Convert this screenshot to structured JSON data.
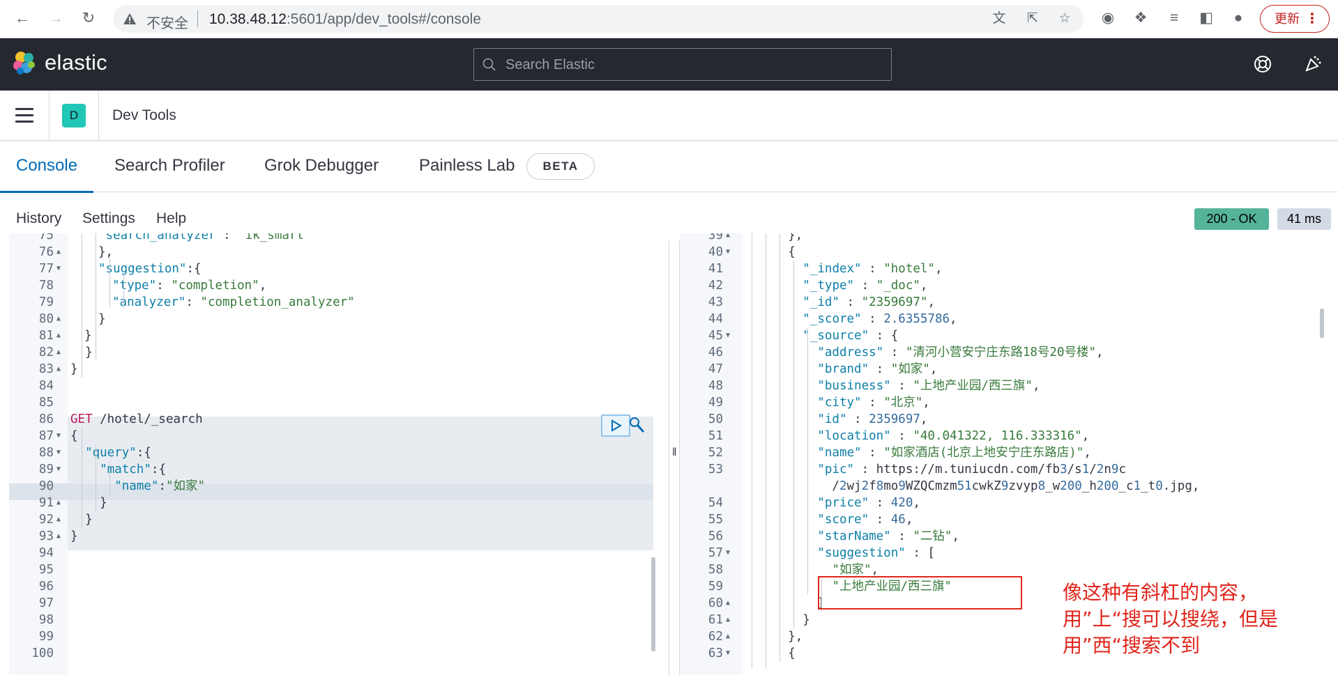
{
  "browser": {
    "insecure_label": "不安全",
    "url_host": "10.38.48.12",
    "url_rest": ":5601/app/dev_tools#/console",
    "update_label": "更新"
  },
  "header": {
    "logo_text": "elastic",
    "search_placeholder": "Search Elastic"
  },
  "breadcrumb": {
    "space_initial": "D",
    "title": "Dev Tools"
  },
  "tabs": [
    {
      "label": "Console"
    },
    {
      "label": "Search Profiler"
    },
    {
      "label": "Grok Debugger"
    },
    {
      "label": "Painless Lab"
    }
  ],
  "beta_label": "BETA",
  "toolbar": {
    "history": "History",
    "settings": "Settings",
    "help": "Help"
  },
  "response_status": "200 - OK",
  "response_time": "41 ms",
  "request_lines": [
    {
      "n": "75",
      "fold": "",
      "indent": 2,
      "text": "\"search_analyzer\": \"ik_smart\""
    },
    {
      "n": "76",
      "fold": "▲",
      "indent": 2,
      "text": "},"
    },
    {
      "n": "77",
      "fold": "▼",
      "indent": 2,
      "text": "\"suggestion\":{"
    },
    {
      "n": "78",
      "fold": "",
      "indent": 3,
      "text": "\"type\": \"completion\","
    },
    {
      "n": "79",
      "fold": "",
      "indent": 3,
      "text": "\"analyzer\": \"completion_analyzer\""
    },
    {
      "n": "80",
      "fold": "▲",
      "indent": 2,
      "text": "}"
    },
    {
      "n": "81",
      "fold": "▲",
      "indent": 1,
      "text": "}"
    },
    {
      "n": "82",
      "fold": "▲",
      "indent": 0,
      "text": "  }"
    },
    {
      "n": "83",
      "fold": "▲",
      "indent": 0,
      "text": "}"
    },
    {
      "n": "84",
      "fold": "",
      "indent": 0,
      "text": ""
    },
    {
      "n": "85",
      "fold": "",
      "indent": 0,
      "text": ""
    },
    {
      "n": "86",
      "fold": "",
      "indent": 0,
      "text": "GET /hotel/_search"
    },
    {
      "n": "87",
      "fold": "▼",
      "indent": 0,
      "text": "{"
    },
    {
      "n": "88",
      "fold": "▼",
      "indent": 0,
      "text": "  \"query\":{"
    },
    {
      "n": "89",
      "fold": "▼",
      "indent": 0,
      "text": "    \"match\":{"
    },
    {
      "n": "90",
      "fold": "",
      "indent": 0,
      "text": "      \"name\":\"如家\""
    },
    {
      "n": "91",
      "fold": "▲",
      "indent": 0,
      "text": "    }"
    },
    {
      "n": "92",
      "fold": "▲",
      "indent": 0,
      "text": "  }"
    },
    {
      "n": "93",
      "fold": "▲",
      "indent": 0,
      "text": "}"
    },
    {
      "n": "94",
      "fold": "",
      "indent": 0,
      "text": ""
    },
    {
      "n": "95",
      "fold": "",
      "indent": 0,
      "text": ""
    },
    {
      "n": "96",
      "fold": "",
      "indent": 0,
      "text": ""
    },
    {
      "n": "97",
      "fold": "",
      "indent": 0,
      "text": ""
    },
    {
      "n": "98",
      "fold": "",
      "indent": 0,
      "text": ""
    },
    {
      "n": "99",
      "fold": "",
      "indent": 0,
      "text": ""
    },
    {
      "n": "100",
      "fold": "",
      "indent": 0,
      "text": ""
    }
  ],
  "response_lines": [
    {
      "n": "39",
      "fold": "▲",
      "text": "      },"
    },
    {
      "n": "40",
      "fold": "▼",
      "text": "      {"
    },
    {
      "n": "41",
      "fold": "",
      "text": "        \"_index\" : \"hotel\","
    },
    {
      "n": "42",
      "fold": "",
      "text": "        \"_type\" : \"_doc\","
    },
    {
      "n": "43",
      "fold": "",
      "text": "        \"_id\" : \"2359697\","
    },
    {
      "n": "44",
      "fold": "",
      "text": "        \"_score\" : 2.6355786,"
    },
    {
      "n": "45",
      "fold": "▼",
      "text": "        \"_source\" : {"
    },
    {
      "n": "46",
      "fold": "",
      "text": "          \"address\" : \"清河小营安宁庄东路18号20号楼\","
    },
    {
      "n": "47",
      "fold": "",
      "text": "          \"brand\" : \"如家\","
    },
    {
      "n": "48",
      "fold": "",
      "text": "          \"business\" : \"上地产业园/西三旗\","
    },
    {
      "n": "49",
      "fold": "",
      "text": "          \"city\" : \"北京\","
    },
    {
      "n": "50",
      "fold": "",
      "text": "          \"id\" : 2359697,"
    },
    {
      "n": "51",
      "fold": "",
      "text": "          \"location\" : \"40.041322, 116.333316\","
    },
    {
      "n": "52",
      "fold": "",
      "text": "          \"name\" : \"如家酒店(北京上地安宁庄东路店)\","
    },
    {
      "n": "53",
      "fold": "",
      "text": "          \"pic\" : \"https://m.tuniucdn.com/fb3/s1/2n9c"
    },
    {
      "n": "",
      "fold": "",
      "text": "            /2wj2f8mo9WZQCmzm51cwkZ9zvyp8_w200_h200_c1_t0.jpg\","
    },
    {
      "n": "54",
      "fold": "",
      "text": "          \"price\" : 420,"
    },
    {
      "n": "55",
      "fold": "",
      "text": "          \"score\" : 46,"
    },
    {
      "n": "56",
      "fold": "",
      "text": "          \"starName\" : \"二钻\","
    },
    {
      "n": "57",
      "fold": "▼",
      "text": "          \"suggestion\" : ["
    },
    {
      "n": "58",
      "fold": "",
      "text": "            \"如家\","
    },
    {
      "n": "59",
      "fold": "",
      "text": "            \"上地产业园/西三旗\""
    },
    {
      "n": "60",
      "fold": "▲",
      "text": "          ]"
    },
    {
      "n": "61",
      "fold": "▲",
      "text": "        }"
    },
    {
      "n": "62",
      "fold": "▲",
      "text": "      },"
    },
    {
      "n": "63",
      "fold": "▼",
      "text": "      {"
    }
  ],
  "annotation": "像这种有斜杠的内容，用”上“搜可以搜绕，但是用”西“搜索不到",
  "colors": {
    "header_bg": "#25282f",
    "accent": "#006bb8",
    "success": "#54b399",
    "space": "#20c6b6",
    "annotation": "#e0261c"
  }
}
